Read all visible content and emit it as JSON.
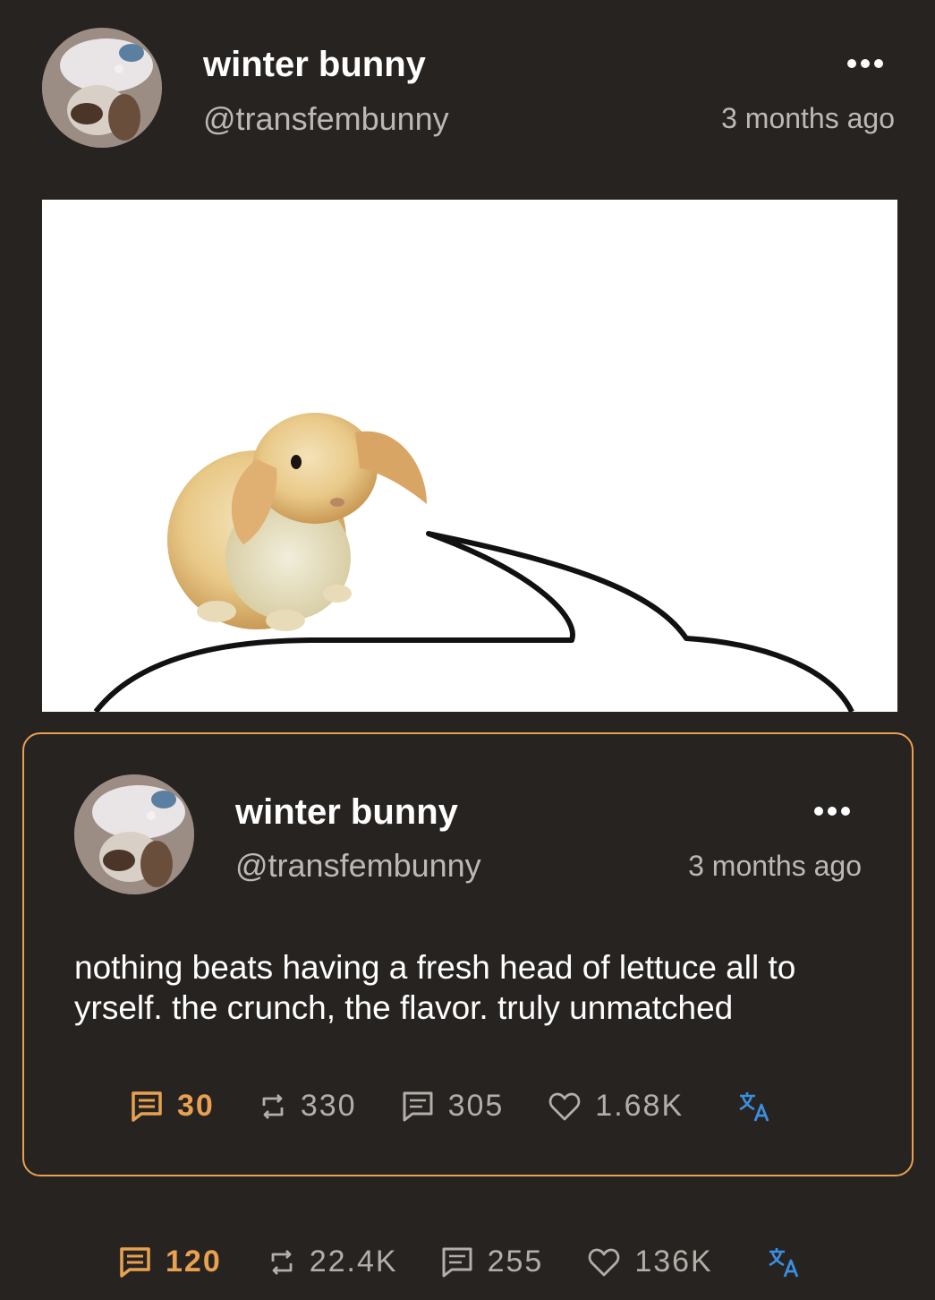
{
  "post": {
    "author_name": "winter bunny",
    "author_handle": "@transfembunny",
    "timestamp": "3 months ago",
    "stats": {
      "replies": "120",
      "reblogs": "22.4K",
      "quotes": "255",
      "likes": "136K"
    }
  },
  "quoted_post": {
    "author_name": "winter bunny",
    "author_handle": "@transfembunny",
    "timestamp": "3 months ago",
    "text": "nothing beats having a fresh head of lettuce all to yrself. the crunch, the flavor. truly unmatched",
    "stats": {
      "replies": "30",
      "reblogs": "330",
      "quotes": "305",
      "likes": "1.68K"
    }
  },
  "colors": {
    "background": "#272321",
    "accent": "#e8a150",
    "translate": "#3b8fe0",
    "muted": "#b4aea9"
  },
  "icons": [
    "more-icon",
    "reply-icon",
    "reblog-icon",
    "quote-icon",
    "heart-icon",
    "translate-icon"
  ]
}
